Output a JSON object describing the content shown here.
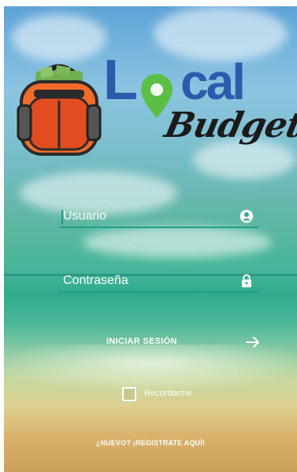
{
  "logo": {
    "word_local_l": "L",
    "word_local_rest": "cal",
    "word_budget": "Budget",
    "brand_blue": "#2a5cab",
    "pin_green": "#5bbf46"
  },
  "login": {
    "username_placeholder": "Usuario",
    "password_placeholder": "Contraseña",
    "submit_label": "INICIAR SESIÓN",
    "remember_label": "Recordarme",
    "signup_link": "¿NUEVO? ¡REGISTRATE AQUÍ!",
    "accent": "#1fa085",
    "icons": {
      "username": "account-circle-icon",
      "password": "lock-icon",
      "submit": "arrow-right-icon"
    }
  }
}
